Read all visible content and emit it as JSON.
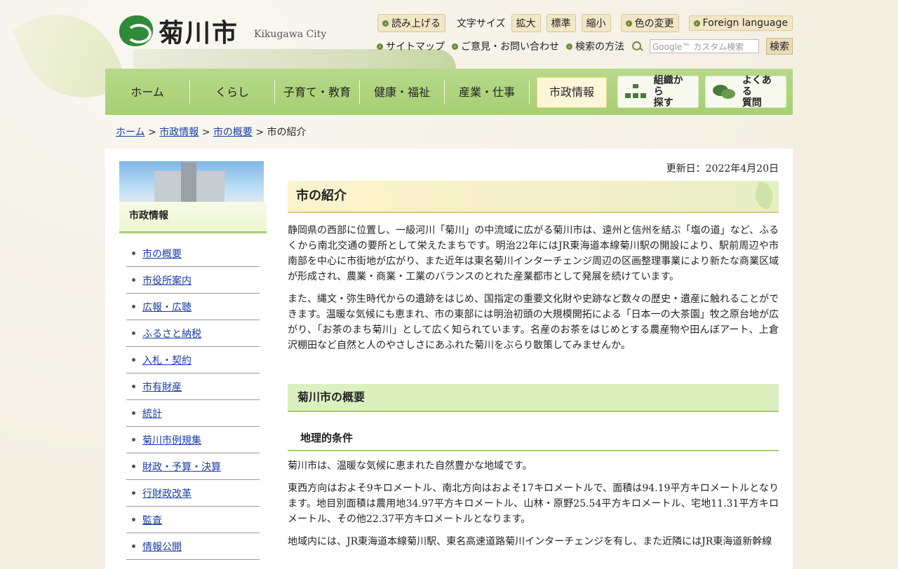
{
  "header": {
    "logo_name": "菊川市",
    "logo_en": "Kikugawa City",
    "tools": {
      "read_aloud": "読み上げる",
      "font_size_label": "文字サイズ",
      "font_large": "拡大",
      "font_standard": "標準",
      "font_small": "縮小",
      "color_change": "色の変更",
      "foreign_language": "Foreign language"
    },
    "links": {
      "sitemap": "サイトマップ",
      "inquiry": "ご意見・お問い合わせ",
      "search_method": "検索の方法"
    },
    "search": {
      "placeholder": "Google™ カスタム検索",
      "button": "検索"
    }
  },
  "nav": {
    "items": [
      "ホーム",
      "くらし",
      "子育て・教育",
      "健康・福祉",
      "産業・仕事",
      "市政情報"
    ],
    "active_index": 5,
    "org_search": "組織から\n探す",
    "faq": "よくある\n質問"
  },
  "breadcrumb": {
    "items": [
      "ホーム",
      "市政情報",
      "市の概要"
    ],
    "current": "市の紹介",
    "separator": ">"
  },
  "sidebar": {
    "heading": "市政情報",
    "items": [
      "市の概要",
      "市役所案内",
      "広報・広聴",
      "ふるさと納税",
      "入札・契約",
      "市有財産",
      "統計",
      "菊川市例規集",
      "財政・予算・決算",
      "行財政改革",
      "監査",
      "情報公開"
    ]
  },
  "main": {
    "updated": "更新日：2022年4月20日",
    "title": "市の紹介",
    "para1": "静岡県の西部に位置し、一級河川「菊川」の中流域に広がる菊川市は、遠州と信州を結ぶ「塩の道」など、ふるくから南北交通の要所として栄えたまちです。明治22年にはJR東海道本線菊川駅の開設により、駅前周辺や市南部を中心に市街地が広がり、また近年は東名菊川インターチェンジ周辺の区画整理事業により新たな商業区域が形成され、農業・商業・工業のバランスのとれた産業都市として発展を続けています。",
    "para2": "また、縄文・弥生時代からの遺跡をはじめ、国指定の重要文化財や史跡など数々の歴史・遺産に触れることができます。温暖な気候にも恵まれ、市の東部には明治初頭の大規模開拓による「日本一の大茶園」牧之原台地が広がり、「お茶のまち菊川」として広く知られています。名産のお茶をはじめとする農産物や田んぼアート、上倉沢棚田など自然と人のやさしさにあふれた菊川をぶらり散策してみませんか。",
    "h2": "菊川市の概要",
    "h3": "地理的条件",
    "para3": "菊川市は、温暖な気候に恵まれた自然豊かな地域です。",
    "para4": "東西方向はおよそ9キロメートル、南北方向はおよそ17キロメートルで、面積は94.19平方キロメートルとなります。地目別面積は農用地34.97平方キロメートル、山林・原野25.54平方キロメートル、宅地11.31平方キロメートル、その他22.37平方キロメートルとなります。",
    "para5": "地域内には、JR東海道本線菊川駅、東名高速道路菊川インターチェンジを有し、また近隣にはJR東海道新幹線"
  }
}
